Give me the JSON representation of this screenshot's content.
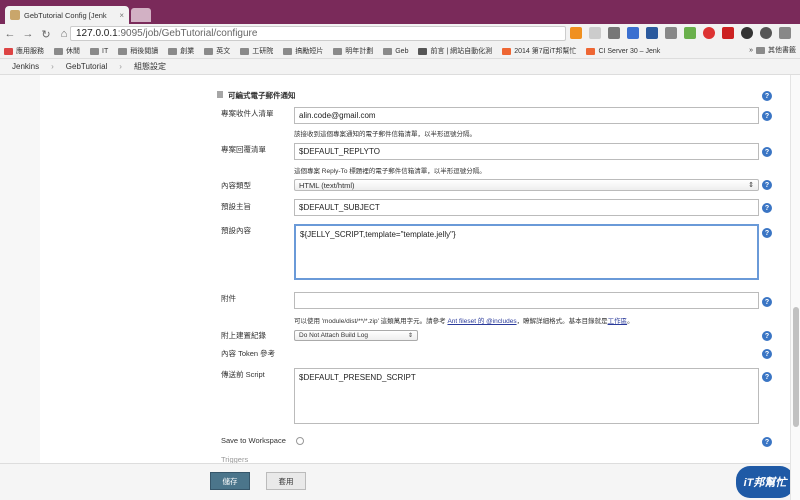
{
  "browser": {
    "tab_title": "GebTutorial Config [Jenk",
    "url_host": "127.0.0.1",
    "url_path": ":9095/job/GebTutorial/configure"
  },
  "bookmarks": [
    "應用服務",
    "休閒",
    "IT",
    "稍後閱讀",
    "創業",
    "英文",
    "工研院",
    "搞勵短片",
    "明年計劃",
    "Geb",
    "前言 | 網站自動化測",
    "2014 第7屆iT邦幫忙",
    "CI Server 30 – Jenk",
    "其他書籤"
  ],
  "breadcrumb": [
    "Jenkins",
    "GebTutorial",
    "組態設定"
  ],
  "section_title": "可編式電子郵件通知",
  "fields": {
    "recipients": {
      "label": "專案收件人清單",
      "value": "alin.code@gmail.com",
      "desc": "該接收到這個專案通知的電子郵件信箱清單，以半形逗號分隔。"
    },
    "replyto": {
      "label": "專案回覆清單",
      "value": "$DEFAULT_REPLYTO",
      "desc": "這個專案 Reply-To 標題裡的電子郵件信箱清單，以半形逗號分隔。"
    },
    "content_type": {
      "label": "內容類型",
      "value": "HTML (text/html)"
    },
    "subject": {
      "label": "預設主旨",
      "value": "$DEFAULT_SUBJECT"
    },
    "content": {
      "label": "預設內容",
      "value": "${JELLY_SCRIPT,template=\"template.jelly\"}"
    },
    "attachments": {
      "label": "附件",
      "value": "",
      "desc_pre": "可以使用 'module/dist/**/*.zip' 這類萬用字元。請參考",
      "desc_link1": "Ant fileset 的 @includes",
      "desc_mid": "，瞭解詳細格式。基本目錄就是",
      "desc_link2": "工作區",
      "desc_post": "。"
    },
    "build_log": {
      "label": "附上建置紀錄",
      "value": "Do Not Attach Build Log"
    },
    "token_ref": {
      "label": "內容 Token 參考"
    },
    "presend": {
      "label": "傳送前 Script",
      "value": "$DEFAULT_PRESEND_SCRIPT"
    },
    "workspace": {
      "label": "Save to Workspace"
    },
    "triggers": {
      "label": "Triggers"
    }
  },
  "buttons": {
    "save": "儲存",
    "apply": "套用"
  },
  "help_glyph": "?",
  "logo_text": "iT邦幫忙"
}
